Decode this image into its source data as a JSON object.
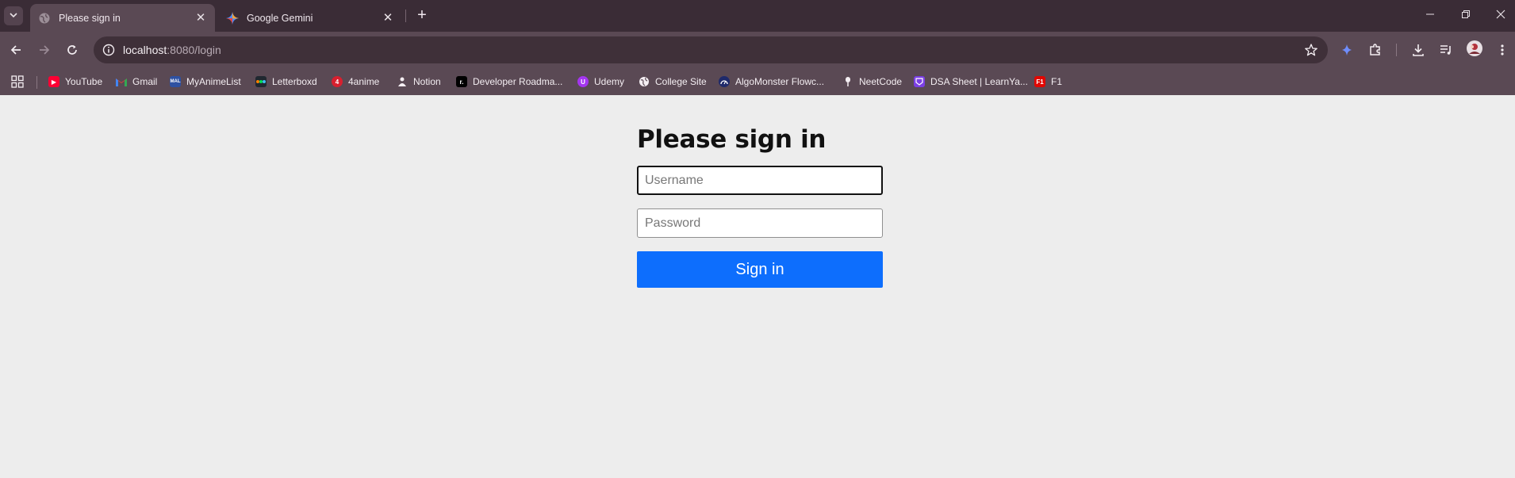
{
  "browser": {
    "tabs": [
      {
        "title": "Please sign in",
        "favicon": "globe-icon",
        "active": true
      },
      {
        "title": "Google Gemini",
        "favicon": "gemini-icon",
        "active": false
      }
    ],
    "url_host": "localhost",
    "url_rest": ":8080/login",
    "bookmarks": [
      {
        "label": "YouTube",
        "icon": "youtube-icon",
        "color": "#ff0033"
      },
      {
        "label": "Gmail",
        "icon": "gmail-icon",
        "color": "#ea4335"
      },
      {
        "label": "MyAnimeList",
        "icon": "myanimelist-icon",
        "color": "#2e51a2"
      },
      {
        "label": "Letterboxd",
        "icon": "letterboxd-icon",
        "color": "#202830"
      },
      {
        "label": "4anime",
        "icon": "4anime-icon",
        "color": "#d8202f"
      },
      {
        "label": "Notion",
        "icon": "notion-icon",
        "color": "#ffffff"
      },
      {
        "label": "Developer Roadma...",
        "icon": "roadmap-icon",
        "color": "#000000"
      },
      {
        "label": "Udemy",
        "icon": "udemy-icon",
        "color": "#a435f0"
      },
      {
        "label": "College Site",
        "icon": "globe-icon",
        "color": "#ffffff"
      },
      {
        "label": "AlgoMonster Flowc...",
        "icon": "algomonster-icon",
        "color": "#1f2a6b"
      },
      {
        "label": "NeetCode",
        "icon": "neetcode-icon",
        "color": "#ffffff"
      },
      {
        "label": "DSA Sheet | LearnYa...",
        "icon": "learnyard-icon",
        "color": "#7b3fe4"
      },
      {
        "label": "F1",
        "icon": "f1-icon",
        "color": "#e10600"
      }
    ]
  },
  "page": {
    "heading": "Please sign in",
    "username_placeholder": "Username",
    "password_placeholder": "Password",
    "submit_label": "Sign in",
    "accent_color": "#0d6efd"
  }
}
